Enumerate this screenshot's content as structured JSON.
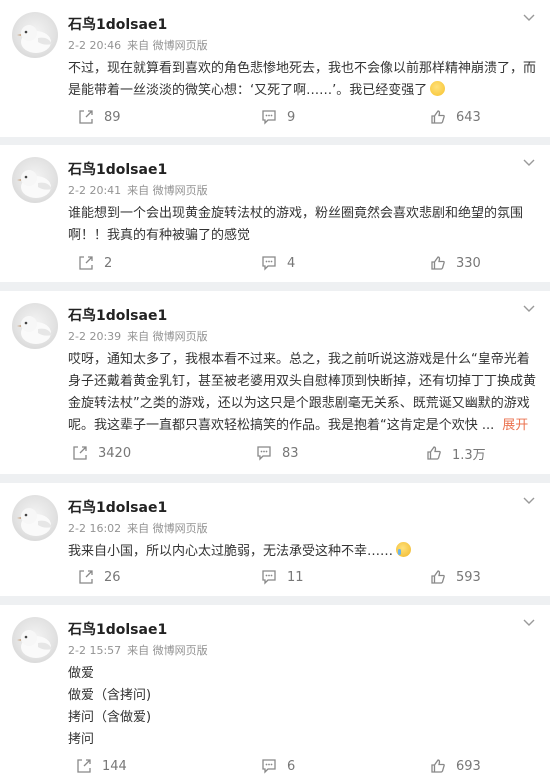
{
  "posts": [
    {
      "username": "石鸟1dolsae1",
      "time": "2-2 20:46",
      "source": "来自 微博网页版",
      "lines": [
        "不过，现在就算看到喜欢的角色悲惨地死去，我也不会像以前那样精神崩溃了，而",
        "是能带着一丝淡淡的微笑心想：‘又死了啊……’。我已经变强了"
      ],
      "emoji": "smile-emoji",
      "reposts": "89",
      "comments": "9",
      "likes": "643"
    },
    {
      "username": "石鸟1dolsae1",
      "time": "2-2 20:41",
      "source": "来自 微博网页版",
      "lines": [
        "谁能想到一个会出现黄金旋转法杖的游戏，粉丝圈竟然会喜欢悲剧和绝望的氛围",
        "啊！！我真的有种被骗了的感觉"
      ],
      "reposts": "2",
      "comments": "4",
      "likes": "330"
    },
    {
      "username": "石鸟1dolsae1",
      "time": "2-2 20:39",
      "source": "来自 微博网页版",
      "lines": [
        "哎呀，通知太多了，我根本看不过来。总之，我之前听说这游戏是什么“皇帝光着",
        "身子还戴着黄金乳钉，甚至被老婆用双头自慰棒顶到快断掉，还有切掉丁丁换成黄",
        "金旋转法杖”之类的游戏，还以为这只是个跟悲剧毫无关系、既荒诞又幽默的游戏",
        "呢。我这辈子一直都只喜欢轻松搞笑的作品。我是抱着“这肯定是个欢快  ..."
      ],
      "expand_label": "展开",
      "reposts": "3420",
      "comments": "83",
      "likes": "1.3万"
    },
    {
      "username": "石鸟1dolsae1",
      "time": "2-2 16:02",
      "source": "来自 微博网页版",
      "lines": [
        "我来自小国，所以内心太过脆弱，无法承受这种不幸……"
      ],
      "emoji": "crying-emoji",
      "reposts": "26",
      "comments": "11",
      "likes": "593"
    },
    {
      "username": "石鸟1dolsae1",
      "time": "2-2 15:57",
      "source": "来自 微博网页版",
      "lines": [
        "做爱",
        "做爱（含拷问)",
        "拷问（含做爱)",
        "拷问"
      ],
      "reposts": "144",
      "comments": "6",
      "likes": "693"
    }
  ],
  "colors": {
    "background": "#eef0f2",
    "card": "#ffffff",
    "accent": "#eb7350",
    "meta": "#939393"
  }
}
